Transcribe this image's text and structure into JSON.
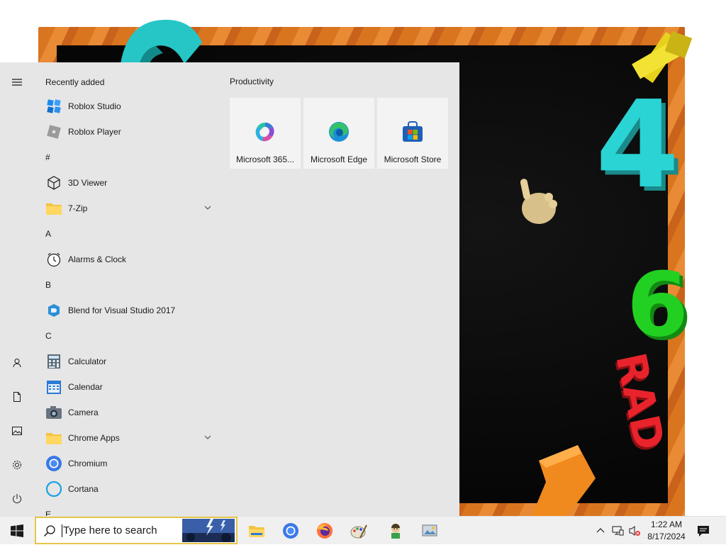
{
  "start_menu": {
    "recently_added_label": "Recently added",
    "tiles_group_title": "Productivity",
    "apps": [
      {
        "kind": "app",
        "label": "Roblox Studio",
        "icon": "roblox-studio-icon"
      },
      {
        "kind": "app",
        "label": "Roblox Player",
        "icon": "roblox-player-icon"
      },
      {
        "kind": "letter",
        "label": "#"
      },
      {
        "kind": "app",
        "label": "3D Viewer",
        "icon": "cube-icon"
      },
      {
        "kind": "folder",
        "label": "7-Zip",
        "icon": "folder-icon"
      },
      {
        "kind": "letter",
        "label": "A"
      },
      {
        "kind": "app",
        "label": "Alarms & Clock",
        "icon": "clock-icon"
      },
      {
        "kind": "letter",
        "label": "B"
      },
      {
        "kind": "app",
        "label": "Blend for Visual Studio 2017",
        "icon": "blend-icon"
      },
      {
        "kind": "letter",
        "label": "C"
      },
      {
        "kind": "app",
        "label": "Calculator",
        "icon": "calculator-icon"
      },
      {
        "kind": "app",
        "label": "Calendar",
        "icon": "calendar-icon"
      },
      {
        "kind": "app",
        "label": "Camera",
        "icon": "camera-icon"
      },
      {
        "kind": "folder",
        "label": "Chrome Apps",
        "icon": "folder-icon"
      },
      {
        "kind": "app",
        "label": "Chromium",
        "icon": "chromium-icon"
      },
      {
        "kind": "app",
        "label": "Cortana",
        "icon": "cortana-icon"
      },
      {
        "kind": "letter",
        "label": "E"
      }
    ],
    "tiles": [
      {
        "label": "Microsoft 365...",
        "icon": "microsoft-365-icon"
      },
      {
        "label": "Microsoft Edge",
        "icon": "edge-icon"
      },
      {
        "label": "Microsoft Store",
        "icon": "store-icon"
      }
    ],
    "rail": [
      "hamburger-menu-icon",
      "user-icon",
      "documents-icon",
      "pictures-icon",
      "settings-icon",
      "power-icon"
    ]
  },
  "taskbar": {
    "search_placeholder": "Type here to search",
    "pinned": [
      "file-explorer-icon",
      "chromium-icon",
      "firefox-icon",
      "paint-icon",
      "avatar-app-icon",
      "media-app-icon"
    ],
    "tray": [
      "chevron-up-icon",
      "network-icon",
      "volume-muted-icon"
    ],
    "time": "1:22 AM",
    "date": "8/17/2024",
    "notification_icon": "action-center-icon"
  },
  "wallpaper": {
    "art_labels": {
      "four": "4",
      "six": "6",
      "rad": "RAD",
      "plus": "+"
    }
  }
}
